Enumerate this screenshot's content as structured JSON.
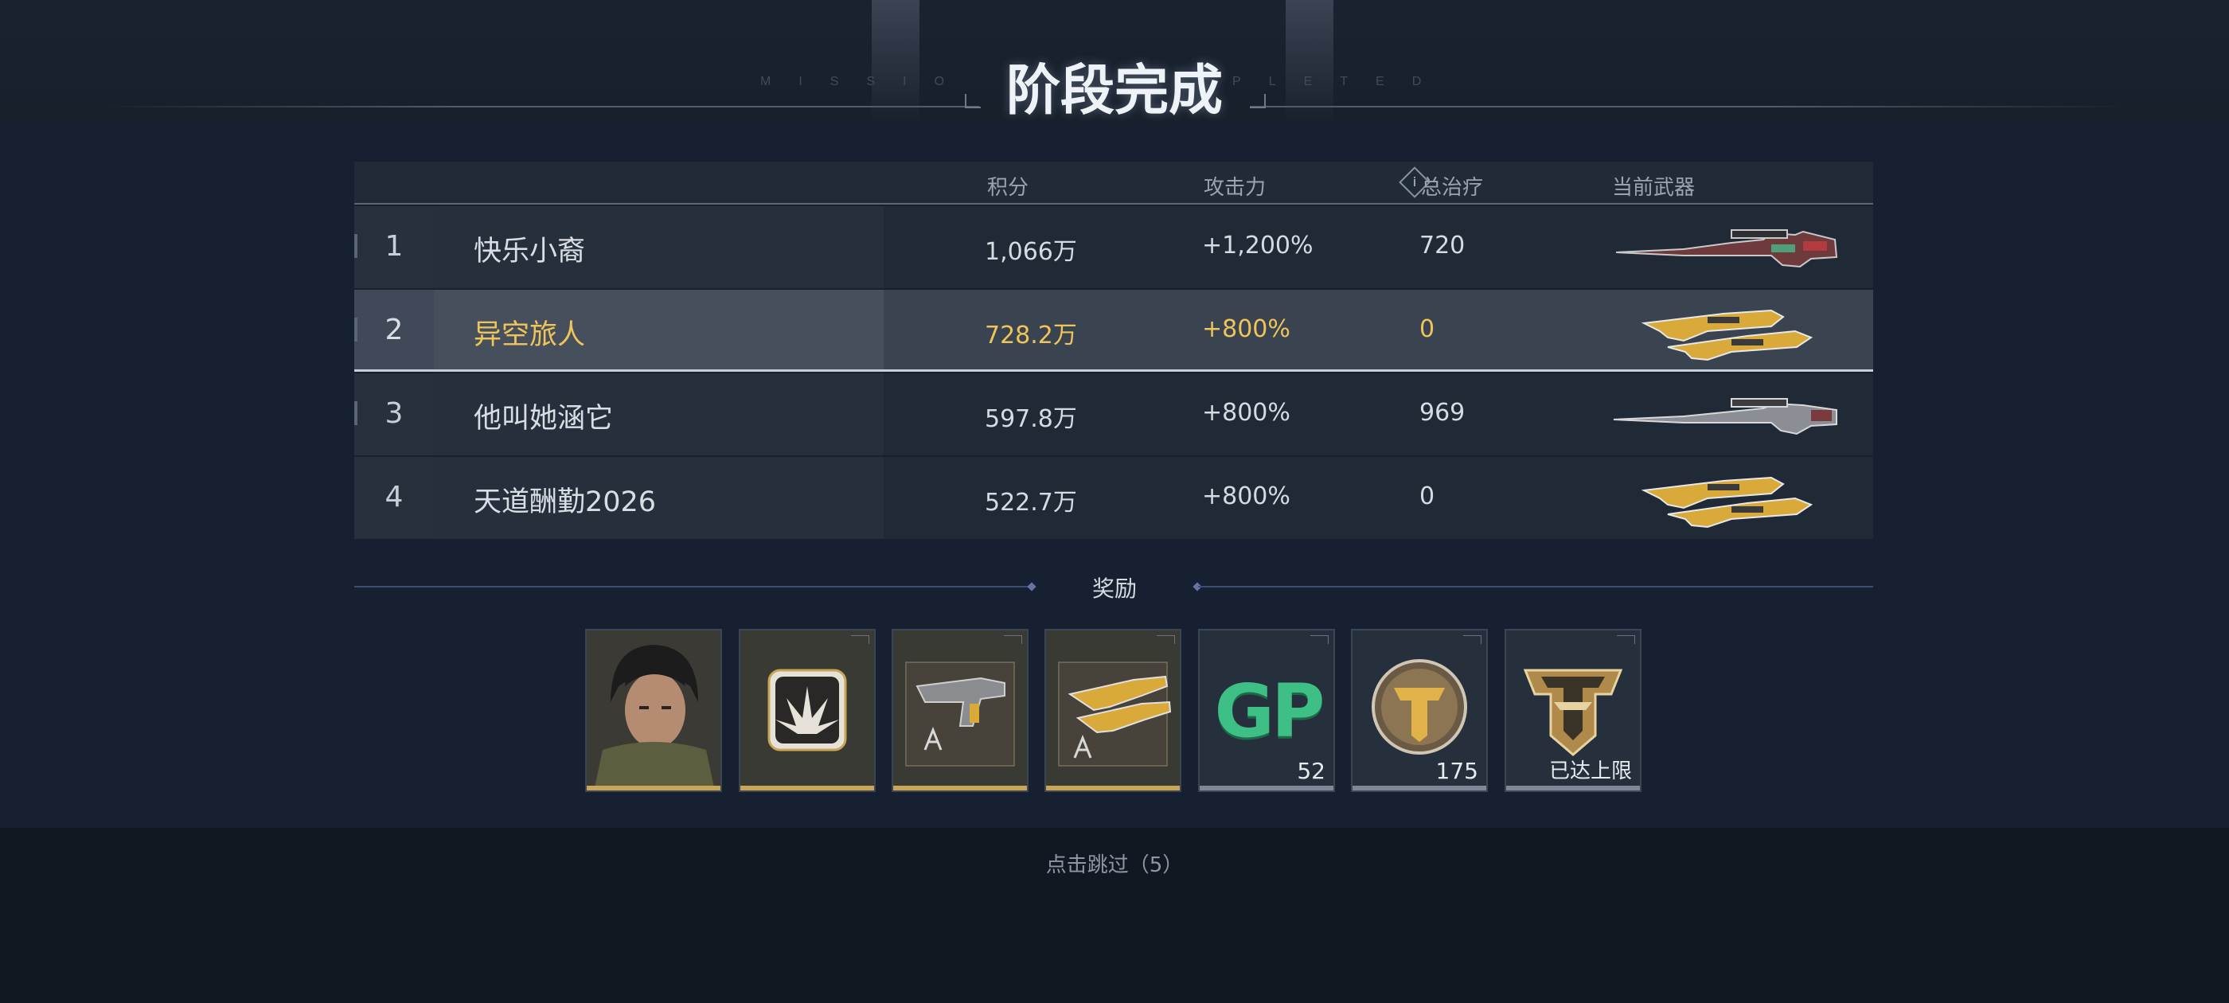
{
  "header": {
    "title": "阶段完成",
    "subtitle_left": "MISSIO",
    "subtitle_right": "PLETED"
  },
  "table": {
    "headers": {
      "score": "积分",
      "score_info": "i",
      "attack": "攻击力",
      "heal": "总治疗",
      "weapon": "当前武器"
    },
    "rows": [
      {
        "rank": "1",
        "name": "快乐小裔",
        "score": "1,066万",
        "attack": "+1,200%",
        "heal": "720",
        "weapon_icon": "sniper-rifle-red-icon",
        "highlight": false
      },
      {
        "rank": "2",
        "name": "异空旅人",
        "score": "728.2万",
        "attack": "+800%",
        "heal": "0",
        "weapon_icon": "dual-gold-rifles-icon",
        "highlight": true
      },
      {
        "rank": "3",
        "name": "他叫她涵它",
        "score": "597.8万",
        "attack": "+800%",
        "heal": "969",
        "weapon_icon": "sniper-rifle-silver-icon",
        "highlight": false
      },
      {
        "rank": "4",
        "name": "天道酬勤2026",
        "score": "522.7万",
        "attack": "+800%",
        "heal": "0",
        "weapon_icon": "dual-gold-rifles-icon",
        "highlight": false
      }
    ]
  },
  "rewards": {
    "label": "奖励",
    "items": [
      {
        "icon": "character-portrait-icon",
        "qty": ""
      },
      {
        "icon": "skill-emblem-icon",
        "qty": ""
      },
      {
        "icon": "pistol-blueprint-icon",
        "qty": ""
      },
      {
        "icon": "rifle-blueprint-icon",
        "qty": ""
      },
      {
        "icon": "gp-currency-icon",
        "text": "GP",
        "qty": "52"
      },
      {
        "icon": "gold-coin-icon",
        "qty": "175"
      },
      {
        "icon": "rank-badge-icon",
        "qty": "已达上限"
      }
    ]
  },
  "footer": {
    "skip": "点击跳过（5）"
  },
  "colors": {
    "highlight_text": "#f0c45a",
    "gold_bar": "#c9a655",
    "gray_bar": "#7d8796"
  }
}
